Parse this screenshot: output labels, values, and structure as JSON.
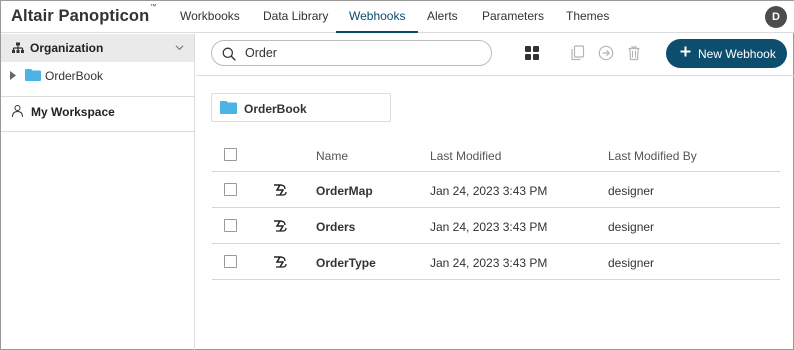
{
  "app": {
    "title": "Altair Panopticon",
    "trademark": "™",
    "nav_tabs": [
      {
        "label": "Workbooks"
      },
      {
        "label": "Data Library"
      },
      {
        "label": "Webhooks"
      },
      {
        "label": "Alerts"
      },
      {
        "label": "Parameters"
      },
      {
        "label": "Themes"
      }
    ],
    "active_tab": "Webhooks",
    "user_initial": "D"
  },
  "sidebar": {
    "organization_label": "Organization",
    "tree_items": [
      {
        "label": "OrderBook",
        "icon": "folder-icon"
      }
    ],
    "workspace_label": "My Workspace"
  },
  "toolbar": {
    "search_value": "Order",
    "new_button_label": "New Webhook"
  },
  "folder_card": {
    "label": "OrderBook"
  },
  "table": {
    "headers": {
      "name": "Name",
      "last_modified": "Last Modified",
      "last_modified_by": "Last Modified By"
    },
    "rows": [
      {
        "name": "OrderMap",
        "last_modified": "Jan 24, 2023 3:43 PM",
        "last_modified_by": "designer"
      },
      {
        "name": "Orders",
        "last_modified": "Jan 24, 2023 3:43 PM",
        "last_modified_by": "designer"
      },
      {
        "name": "OrderType",
        "last_modified": "Jan 24, 2023 3:43 PM",
        "last_modified_by": "designer"
      }
    ]
  },
  "colors": {
    "accent": "#0d4d6d",
    "folder": "#4db3e6",
    "sidebar_selected_bg": "#eaeaea"
  }
}
